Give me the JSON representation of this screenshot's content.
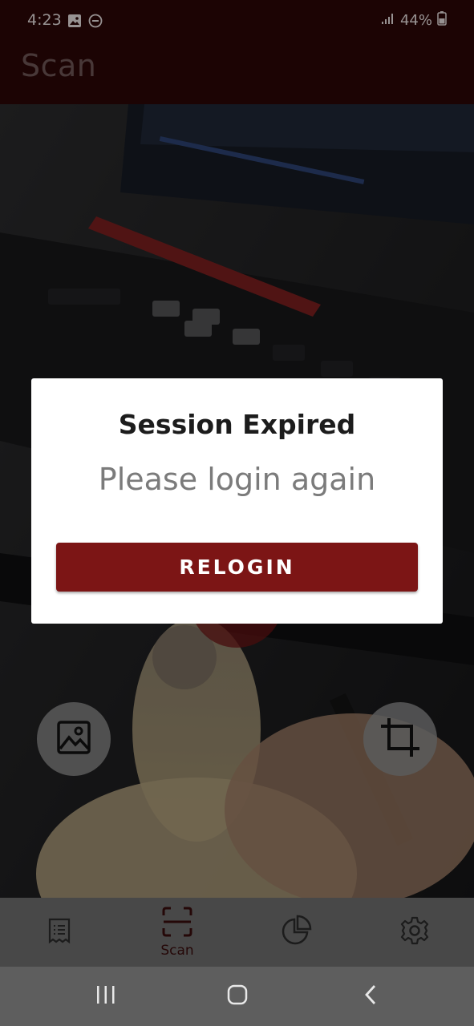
{
  "status_bar": {
    "time": "4:23",
    "battery": "44%",
    "icons": [
      "image-notification-icon",
      "do-not-disturb-icon",
      "signal-icon",
      "battery-icon"
    ]
  },
  "app_bar": {
    "title": "Scan"
  },
  "dialog": {
    "title": "Session Expired",
    "message": "Please login again",
    "button_label": "RELOGIN",
    "button_color": "#7c1515"
  },
  "bottom_nav": {
    "items": [
      {
        "id": "receipts",
        "label": "",
        "icon": "receipt-icon"
      },
      {
        "id": "scan",
        "label": "Scan",
        "icon": "scan-icon",
        "active": true
      },
      {
        "id": "reports",
        "label": "",
        "icon": "pie-chart-icon"
      },
      {
        "id": "settings",
        "label": "",
        "icon": "gear-icon"
      }
    ]
  },
  "colors": {
    "accent": "#7c1515",
    "appbar": "#2c0707"
  }
}
